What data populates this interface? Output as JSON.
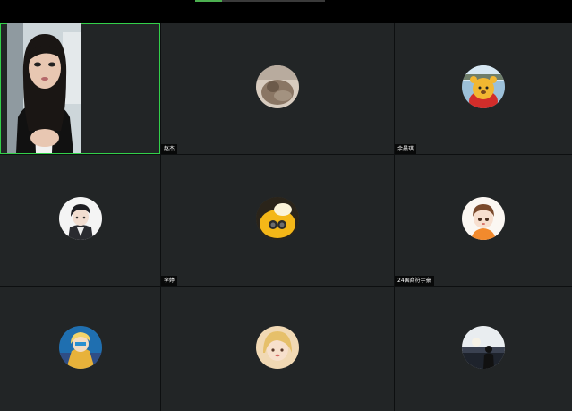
{
  "theme": {
    "tile_background": "#222526",
    "active_border": "#33d04a",
    "accent": "#4caf50"
  },
  "participants": [
    {
      "name": "",
      "video_on": true,
      "active_speaker": true
    },
    {
      "name": "赵杰",
      "avatar_icon": "cat-photo-avatar-icon"
    },
    {
      "name": "余晨琪",
      "avatar_icon": "bear-mascot-avatar-icon"
    },
    {
      "name": "",
      "avatar_icon": "anime-boy-avatar-icon"
    },
    {
      "name": "李婷",
      "avatar_icon": "yellow-cartoon-avatar-icon"
    },
    {
      "name": "24国商符宇豪",
      "avatar_icon": "chibi-boy-avatar-icon"
    },
    {
      "name": "",
      "avatar_icon": "anime-character-blue-avatar-icon"
    },
    {
      "name": "",
      "avatar_icon": "blonde-portrait-avatar-icon"
    },
    {
      "name": "",
      "avatar_icon": "silhouette-sunset-avatar-icon"
    }
  ]
}
